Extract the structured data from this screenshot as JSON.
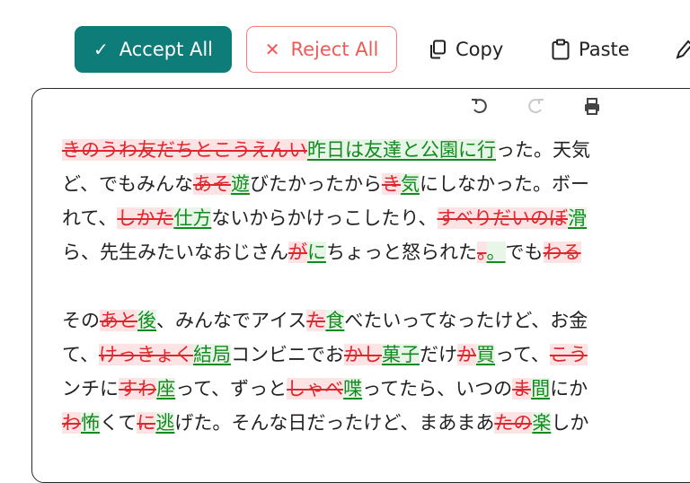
{
  "toolbar": {
    "accept_all": "Accept All",
    "reject_all": "Reject All",
    "copy": "Copy",
    "paste": "Paste"
  },
  "colors": {
    "accent": "#0e7c78",
    "reject": "#ef5a57",
    "deletion": "#e0262d",
    "insertion": "#128a1f"
  },
  "editor_tools": [
    "undo-icon",
    "redo-icon",
    "print-icon"
  ],
  "content": {
    "p1": {
      "l1": {
        "d1": "きのうわ友だちとこうえんい",
        "i1": "昨日は友達と公園に行",
        "t1": "った。天気"
      },
      "l2": {
        "t1": "ど、でもみんな",
        "d1": "あそ",
        "i1": "遊",
        "t2": "びたかったから",
        "d2": "き",
        "i2": "気",
        "t3": "にしなかった。ボー"
      },
      "l3": {
        "t1": "れて、",
        "d1": "しかた",
        "i1": "仕方",
        "t2": "ないからかけっこしたり、",
        "d2": "すべりだいのぼ",
        "i2": "滑"
      },
      "l4": {
        "t1": "ら、先生みたいなおじさん",
        "d1": "が",
        "i1": "に",
        "t2": "ちょっと怒られた",
        "d2": "。",
        "i2": "。",
        "t3": "でも",
        "d3": "わる"
      }
    },
    "p2": {
      "l1": {
        "t1": "その",
        "d1": "あと",
        "i1": "後",
        "t2": "、みんなでアイス",
        "d2": "た",
        "i2": "食",
        "t3": "べたいってなったけど、お金"
      },
      "l2": {
        "t1": "て、",
        "d1": "けっきょく",
        "i1": "結局",
        "t2": "コンビニでお",
        "d2": "かし",
        "i2": "菓子",
        "t3": "だけ",
        "d3": "か",
        "i3": "買",
        "t4": "って、",
        "d4": "こう"
      },
      "l3": {
        "t1": "ンチに",
        "d1": "すわ",
        "i1": "座",
        "t2": "って、ずっと",
        "d2": "しゃべ",
        "i2": "喋",
        "t3": "ってたら、いつの",
        "d3": "ま",
        "i3": "間",
        "t4": "にか"
      },
      "l4": {
        "d1": "わ",
        "i1": "怖",
        "t1": "くて",
        "d2": "に",
        "i2": "逃",
        "t2": "げた。そんな日だったけど、まあまあ",
        "d3": "たの",
        "i3": "楽",
        "t3": "しか"
      }
    }
  }
}
